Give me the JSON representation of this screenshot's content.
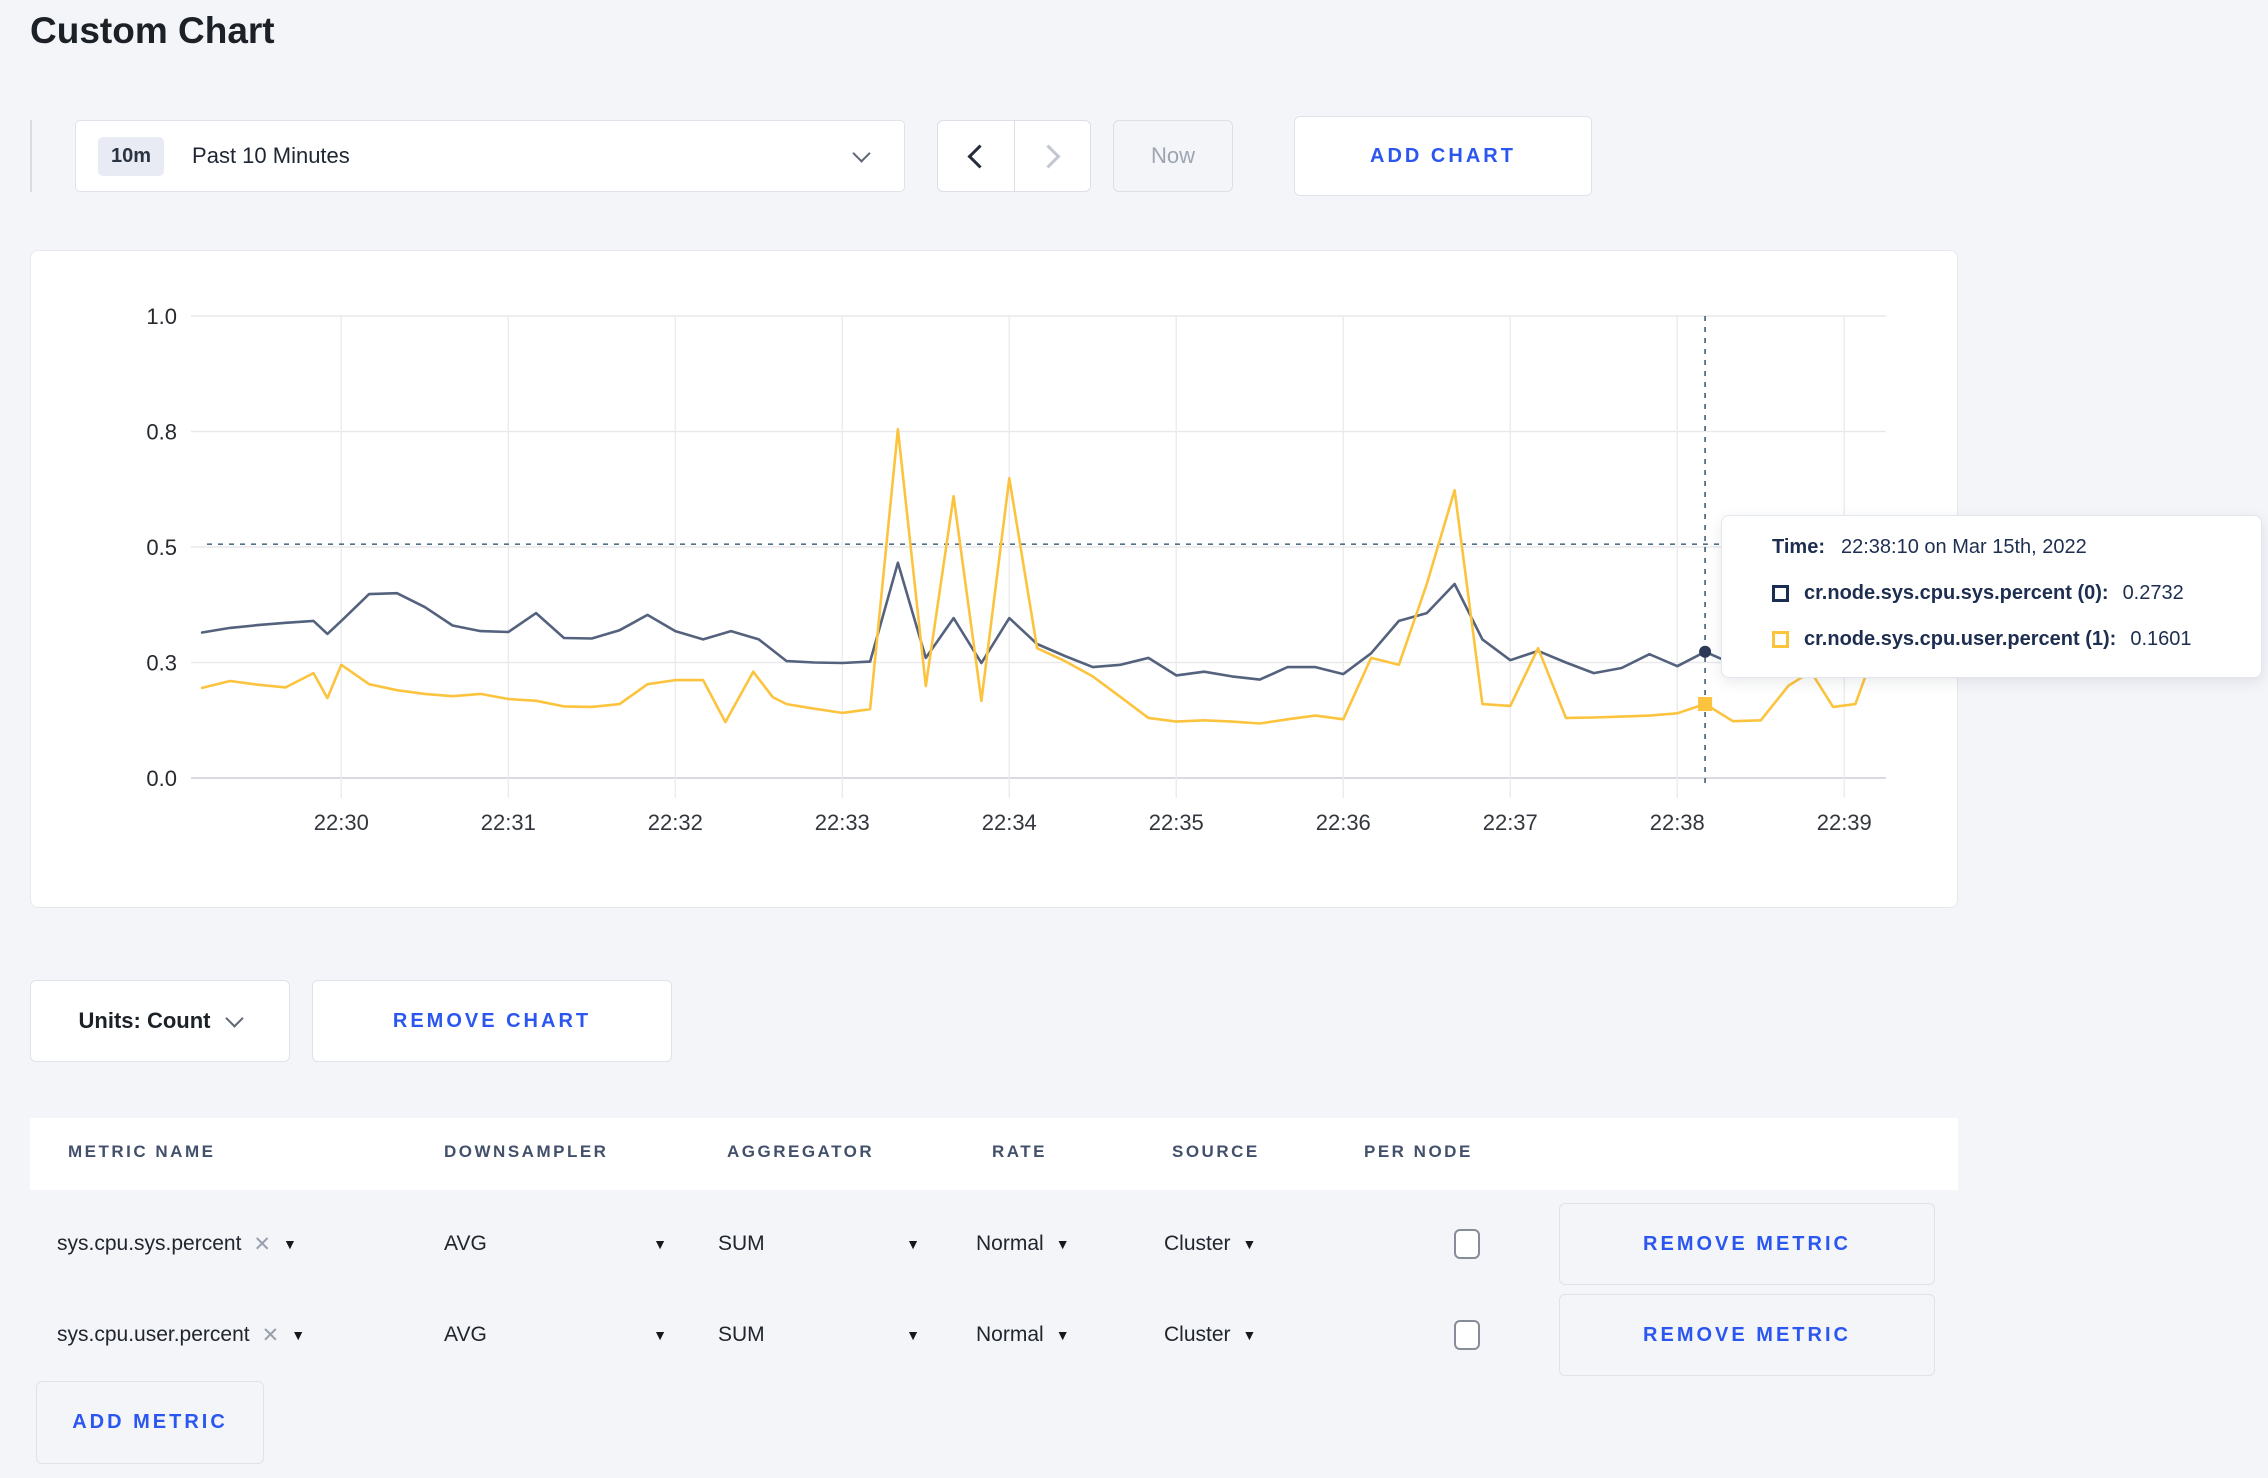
{
  "page": {
    "title": "Custom Chart",
    "background": "#f4f5f9",
    "accent_blue": "#2b57f0"
  },
  "toolbar": {
    "range_badge": "10m",
    "range_label": "Past 10 Minutes",
    "now_label": "Now",
    "add_chart_label": "ADD CHART"
  },
  "tooltip": {
    "time_label": "Time:",
    "time_value": "22:38:10 on Mar 15th, 2022",
    "series": [
      {
        "name": "cr.node.sys.cpu.sys.percent (0):",
        "value": "0.2732",
        "color": "#1b2d52"
      },
      {
        "name": "cr.node.sys.cpu.user.percent (1):",
        "value": "0.1601",
        "color": "#fcc33c"
      }
    ]
  },
  "chart_footer": {
    "units_label": "Units: Count",
    "remove_chart_label": "REMOVE CHART"
  },
  "metrics_table": {
    "headers": [
      "METRIC NAME",
      "DOWNSAMPLER",
      "AGGREGATOR",
      "RATE",
      "SOURCE",
      "PER NODE"
    ],
    "rows": [
      {
        "metric": "sys.cpu.sys.percent",
        "downsampler": "AVG",
        "aggregator": "SUM",
        "rate": "Normal",
        "source": "Cluster",
        "per_node_checked": false,
        "remove_label": "REMOVE METRIC"
      },
      {
        "metric": "sys.cpu.user.percent",
        "downsampler": "AVG",
        "aggregator": "SUM",
        "rate": "Normal",
        "source": "Cluster",
        "per_node_checked": false,
        "remove_label": "REMOVE METRIC"
      }
    ],
    "add_metric_label": "ADD METRIC"
  },
  "chart_data": {
    "type": "line",
    "title": "",
    "xlabel": "",
    "ylabel": "",
    "grid": true,
    "legend_position": "tooltip-only",
    "x_unit": "seconds since 22:30:00 on Mar 15th, 2022",
    "x_domain": [
      -54,
      555
    ],
    "y_domain": [
      0,
      1
    ],
    "x_ticks": [
      {
        "t": 0,
        "label": "22:30"
      },
      {
        "t": 60,
        "label": "22:31"
      },
      {
        "t": 120,
        "label": "22:32"
      },
      {
        "t": 180,
        "label": "22:33"
      },
      {
        "t": 240,
        "label": "22:34"
      },
      {
        "t": 300,
        "label": "22:35"
      },
      {
        "t": 360,
        "label": "22:36"
      },
      {
        "t": 420,
        "label": "22:37"
      },
      {
        "t": 480,
        "label": "22:38"
      },
      {
        "t": 540,
        "label": "22:39"
      }
    ],
    "y_ticks": [
      {
        "v": 0,
        "label": "0.0"
      },
      {
        "v": 0.25,
        "label": "0.3"
      },
      {
        "v": 0.5,
        "label": "0.5"
      },
      {
        "v": 0.75,
        "label": "0.8"
      },
      {
        "v": 1,
        "label": "1.0"
      }
    ],
    "crosshair": {
      "t": 490,
      "v": 0.506,
      "color": "#527086"
    },
    "series": [
      {
        "name": "cr.node.sys.cpu.sys.percent",
        "color": "#54627e",
        "marker": {
          "t": 490,
          "v": 0.2732,
          "shape": "circle",
          "color": "#2c3a57"
        },
        "points": [
          [
            -50,
            0.315
          ],
          [
            -40,
            0.325
          ],
          [
            -30,
            0.331
          ],
          [
            -20,
            0.336
          ],
          [
            -10,
            0.34
          ],
          [
            -5,
            0.312
          ],
          [
            0,
            0.34
          ],
          [
            10,
            0.398
          ],
          [
            20,
            0.4
          ],
          [
            30,
            0.37
          ],
          [
            40,
            0.33
          ],
          [
            50,
            0.318
          ],
          [
            60,
            0.316
          ],
          [
            70,
            0.357
          ],
          [
            80,
            0.303
          ],
          [
            90,
            0.302
          ],
          [
            100,
            0.32
          ],
          [
            110,
            0.353
          ],
          [
            120,
            0.318
          ],
          [
            130,
            0.3
          ],
          [
            140,
            0.318
          ],
          [
            150,
            0.3
          ],
          [
            160,
            0.253
          ],
          [
            170,
            0.25
          ],
          [
            180,
            0.249
          ],
          [
            190,
            0.252
          ],
          [
            200,
            0.466
          ],
          [
            210,
            0.26
          ],
          [
            220,
            0.346
          ],
          [
            230,
            0.249
          ],
          [
            240,
            0.346
          ],
          [
            250,
            0.29
          ],
          [
            260,
            0.264
          ],
          [
            270,
            0.24
          ],
          [
            280,
            0.245
          ],
          [
            290,
            0.26
          ],
          [
            300,
            0.222
          ],
          [
            310,
            0.23
          ],
          [
            320,
            0.22
          ],
          [
            330,
            0.213
          ],
          [
            340,
            0.24
          ],
          [
            350,
            0.24
          ],
          [
            360,
            0.225
          ],
          [
            370,
            0.27
          ],
          [
            380,
            0.34
          ],
          [
            390,
            0.357
          ],
          [
            400,
            0.42
          ],
          [
            410,
            0.3
          ],
          [
            420,
            0.255
          ],
          [
            430,
            0.275
          ],
          [
            440,
            0.25
          ],
          [
            450,
            0.227
          ],
          [
            460,
            0.238
          ],
          [
            470,
            0.268
          ],
          [
            480,
            0.242
          ],
          [
            490,
            0.2732
          ],
          [
            500,
            0.247
          ],
          [
            510,
            0.27
          ],
          [
            520,
            0.29
          ],
          [
            530,
            0.3
          ],
          [
            540,
            0.295
          ],
          [
            550,
            0.3
          ]
        ]
      },
      {
        "name": "cr.node.sys.cpu.user.percent",
        "color": "#fcc43e",
        "marker": {
          "t": 490,
          "v": 0.1601,
          "shape": "square",
          "color": "#fcc43e"
        },
        "points": [
          [
            -50,
            0.195
          ],
          [
            -40,
            0.21
          ],
          [
            -30,
            0.202
          ],
          [
            -20,
            0.196
          ],
          [
            -10,
            0.227
          ],
          [
            -5,
            0.173
          ],
          [
            0,
            0.245
          ],
          [
            10,
            0.203
          ],
          [
            20,
            0.19
          ],
          [
            30,
            0.182
          ],
          [
            40,
            0.177
          ],
          [
            50,
            0.182
          ],
          [
            60,
            0.171
          ],
          [
            70,
            0.167
          ],
          [
            80,
            0.155
          ],
          [
            90,
            0.154
          ],
          [
            100,
            0.16
          ],
          [
            110,
            0.203
          ],
          [
            120,
            0.212
          ],
          [
            130,
            0.212
          ],
          [
            138,
            0.121
          ],
          [
            148,
            0.23
          ],
          [
            155,
            0.175
          ],
          [
            160,
            0.16
          ],
          [
            170,
            0.15
          ],
          [
            180,
            0.141
          ],
          [
            190,
            0.149
          ],
          [
            200,
            0.755
          ],
          [
            210,
            0.199
          ],
          [
            220,
            0.61
          ],
          [
            230,
            0.167
          ],
          [
            240,
            0.649
          ],
          [
            250,
            0.281
          ],
          [
            260,
            0.253
          ],
          [
            270,
            0.22
          ],
          [
            280,
            0.175
          ],
          [
            290,
            0.13
          ],
          [
            300,
            0.122
          ],
          [
            310,
            0.125
          ],
          [
            320,
            0.122
          ],
          [
            330,
            0.118
          ],
          [
            340,
            0.127
          ],
          [
            350,
            0.135
          ],
          [
            360,
            0.127
          ],
          [
            370,
            0.26
          ],
          [
            380,
            0.245
          ],
          [
            390,
            0.42
          ],
          [
            400,
            0.623
          ],
          [
            410,
            0.16
          ],
          [
            420,
            0.156
          ],
          [
            430,
            0.281
          ],
          [
            440,
            0.13
          ],
          [
            450,
            0.131
          ],
          [
            460,
            0.133
          ],
          [
            470,
            0.135
          ],
          [
            480,
            0.14
          ],
          [
            490,
            0.1601
          ],
          [
            500,
            0.123
          ],
          [
            510,
            0.125
          ],
          [
            520,
            0.2
          ],
          [
            528,
            0.23
          ],
          [
            536,
            0.154
          ],
          [
            544,
            0.16
          ],
          [
            550,
            0.26
          ]
        ]
      }
    ]
  }
}
